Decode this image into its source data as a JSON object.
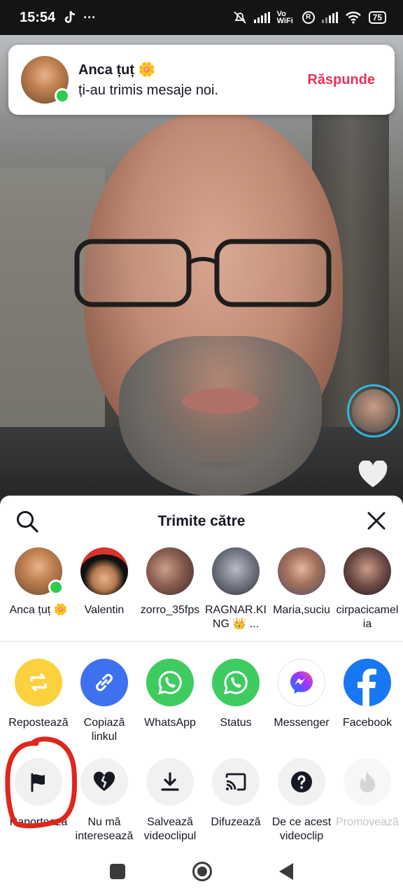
{
  "status_bar": {
    "time": "15:54",
    "more": "···",
    "vowifi": "Vo WiFi",
    "roaming": "R",
    "battery": "75"
  },
  "notification": {
    "sender": "Anca țuț 🌼",
    "message": "ți-au trimis mesaje noi.",
    "reply_label": "Răspunde"
  },
  "share_sheet": {
    "title": "Trimite către",
    "contacts": [
      {
        "name": "Anca țuț 🌼",
        "online": true
      },
      {
        "name": "Valentin"
      },
      {
        "name": "zorro_35fps"
      },
      {
        "name": "RAGNAR.KING 👑 ..."
      },
      {
        "name": "Maria,suciu"
      },
      {
        "name": "cirpacicamelia"
      }
    ],
    "apps": [
      {
        "label": "Repostează",
        "icon": "repost-icon",
        "color": "#fbd23d"
      },
      {
        "label": "Copiază linkul",
        "icon": "link-icon",
        "color": "#3d71f0"
      },
      {
        "label": "WhatsApp",
        "icon": "whatsapp-icon",
        "color": "#3ecb60"
      },
      {
        "label": "Status",
        "icon": "whatsapp-status-icon",
        "color": "#3ecb60"
      },
      {
        "label": "Messenger",
        "icon": "messenger-icon",
        "color": "#ffffff"
      },
      {
        "label": "Facebook",
        "icon": "facebook-icon",
        "color": "#1877f2"
      }
    ],
    "tools": [
      {
        "label": "Raportează",
        "icon": "flag-icon"
      },
      {
        "label": "Nu mă interesează",
        "icon": "broken-heart-icon"
      },
      {
        "label": "Salvează videoclipul",
        "icon": "download-icon"
      },
      {
        "label": "Difuzează",
        "icon": "cast-icon"
      },
      {
        "label": "De ce acest videoclip",
        "icon": "question-icon"
      },
      {
        "label": "Promovează",
        "icon": "flame-icon",
        "disabled": true
      }
    ]
  },
  "colors": {
    "accent_red": "#e4335a",
    "annotation_red": "#e0261b"
  }
}
